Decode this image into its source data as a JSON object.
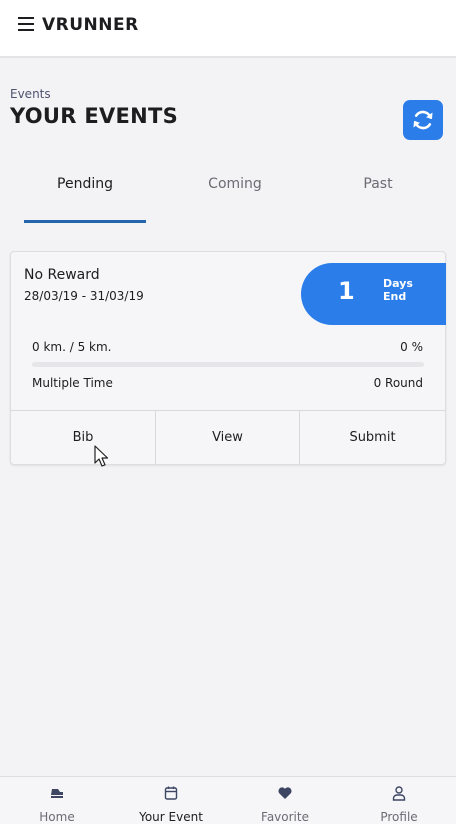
{
  "app": {
    "title": "VRUNNER"
  },
  "header": {
    "section_label": "Events",
    "page_title": "YOUR EVENTS"
  },
  "tabs": [
    {
      "label": "Pending",
      "active": true
    },
    {
      "label": "Coming",
      "active": false
    },
    {
      "label": "Past",
      "active": false
    }
  ],
  "event": {
    "name": "No Reward",
    "dates": "28/03/19 - 31/03/19",
    "days_number": "1",
    "days_label_line1": "Days",
    "days_label_line2": "End",
    "distance": "0 km. / 5 km.",
    "percent": "0 %",
    "progress": 0,
    "mode": "Multiple Time",
    "rounds": "0 Round",
    "actions": {
      "bib": "Bib",
      "view": "View",
      "submit": "Submit"
    }
  },
  "bottom_nav": [
    {
      "label": "Home",
      "icon": "home-shoe-icon",
      "active": false
    },
    {
      "label": "Your Event",
      "icon": "calendar-icon",
      "active": true
    },
    {
      "label": "Favorite",
      "icon": "heart-icon",
      "active": false
    },
    {
      "label": "Profile",
      "icon": "user-icon",
      "active": false
    }
  ],
  "colors": {
    "accent": "#2b7de9",
    "tab_underline": "#2366ad",
    "background": "#f3f3f5"
  }
}
